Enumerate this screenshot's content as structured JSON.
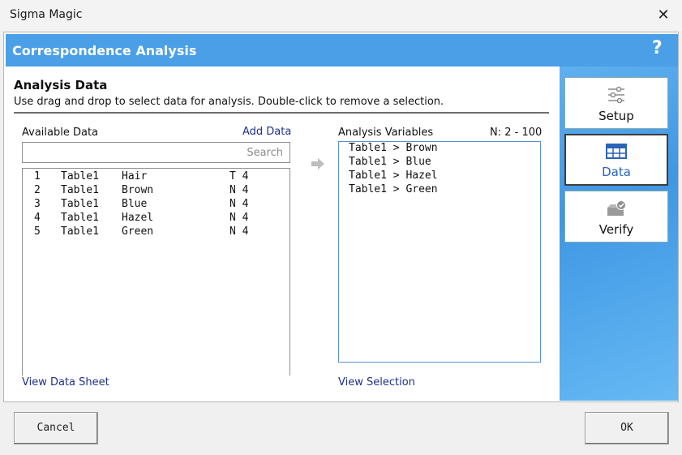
{
  "window": {
    "title": "Sigma Magic",
    "close_glyph": "✕"
  },
  "header": {
    "title": "Correspondence Analysis",
    "help_glyph": "?"
  },
  "section": {
    "title": "Analysis Data",
    "description": "Use drag and drop to select data for analysis. Double-click to remove a selection."
  },
  "available": {
    "label": "Available Data",
    "add_link": "Add Data",
    "search_placeholder": "Search",
    "rows": [
      {
        "num": "1",
        "table": "Table1",
        "name": "Hair",
        "type": "T 4"
      },
      {
        "num": "2",
        "table": "Table1",
        "name": "Brown",
        "type": "N 4"
      },
      {
        "num": "3",
        "table": "Table1",
        "name": "Blue",
        "type": "N 4"
      },
      {
        "num": "4",
        "table": "Table1",
        "name": "Hazel",
        "type": "N 4"
      },
      {
        "num": "5",
        "table": "Table1",
        "name": "Green",
        "type": "N 4"
      }
    ],
    "view_link": "View Data Sheet"
  },
  "analysis": {
    "label": "Analysis Variables",
    "range": "N: 2 - 100",
    "items": [
      "Table1 > Brown",
      "Table1 > Blue",
      "Table1 > Hazel",
      "Table1 > Green"
    ],
    "view_link": "View Selection"
  },
  "nav": {
    "setup": "Setup",
    "data": "Data",
    "verify": "Verify",
    "active": "Data"
  },
  "buttons": {
    "cancel": "Cancel",
    "ok": "OK"
  },
  "colors": {
    "header": "#4a9fe6",
    "link": "#1f2f8a",
    "accent": "#2b63b8"
  }
}
